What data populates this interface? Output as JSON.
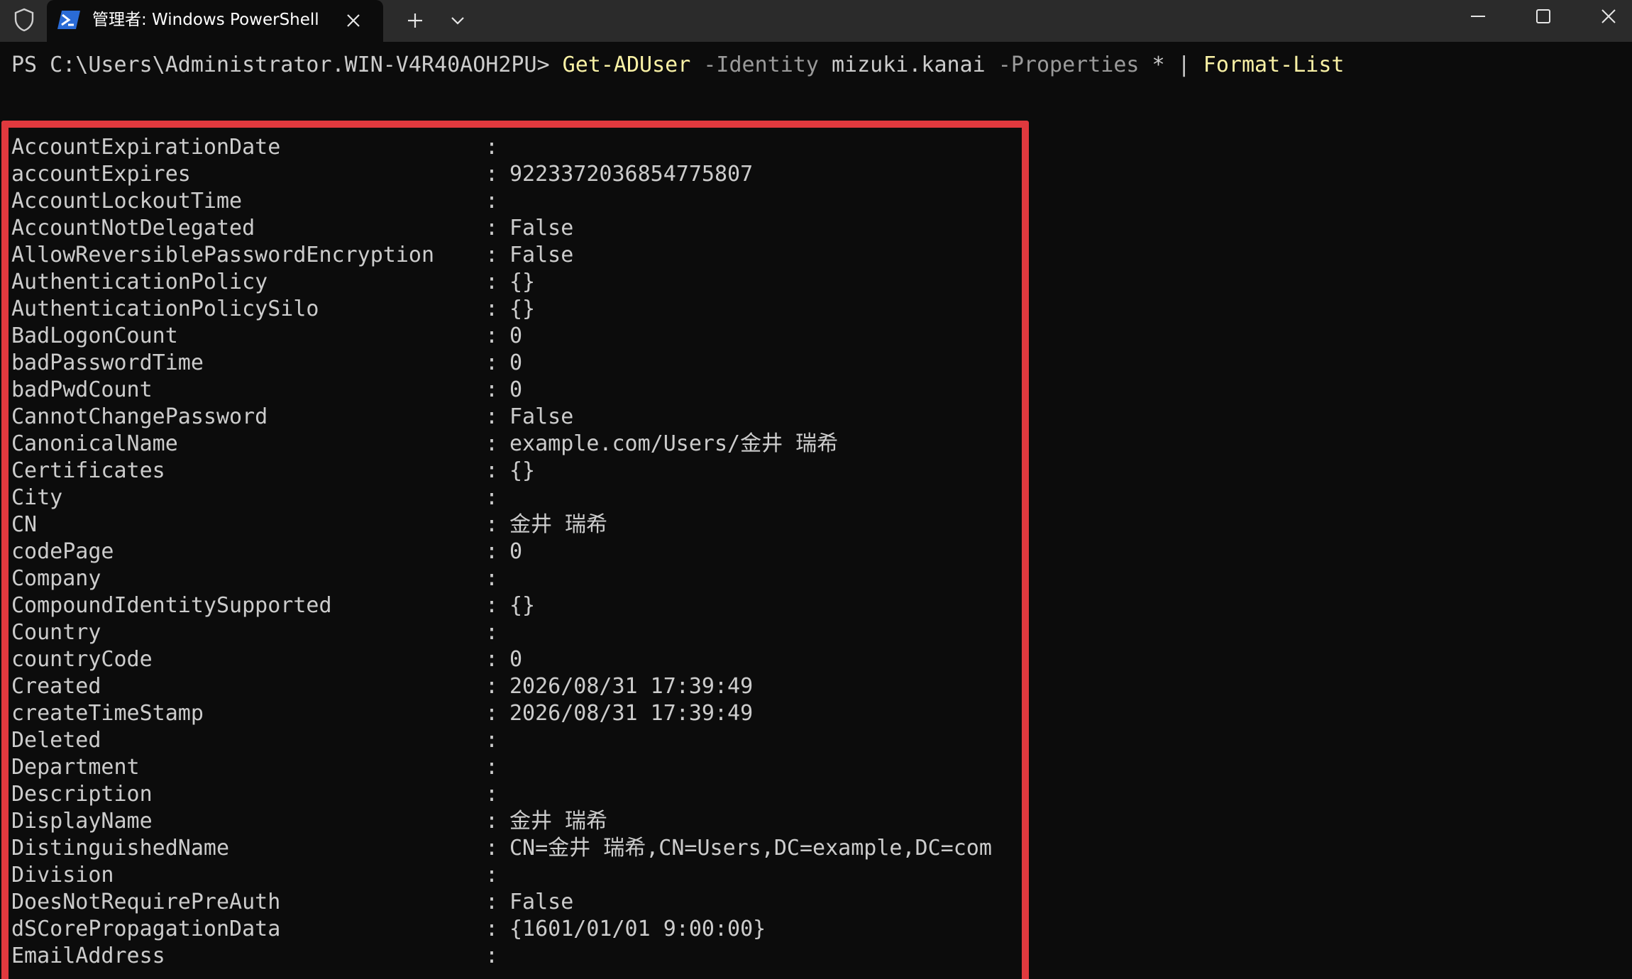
{
  "titlebar": {
    "tab_title": "管理者: Windows PowerShell",
    "icons": {
      "admin": "shield-icon",
      "tab": "powershell-icon",
      "close_tab": "close-icon",
      "new_tab": "plus-icon",
      "dropdown": "chevron-down-icon",
      "minimize": "minimize-icon",
      "maximize": "maximize-icon",
      "close_window": "close-icon"
    }
  },
  "terminal": {
    "prompt": "PS C:\\Users\\Administrator.WIN-V4R40AOH2PU>",
    "command": "Get-ADUser",
    "param_identity": "-Identity",
    "identity_value": "mizuki.kanai",
    "param_properties": "-Properties",
    "properties_value": "*",
    "pipe": "|",
    "pipe_command": "Format-List",
    "separator": ":",
    "colors": {
      "background": "#0c0c0c",
      "text": "#cccccc",
      "command": "#f9f1a5",
      "parameter": "#9a9a9a",
      "highlight_border": "#e0393e"
    },
    "properties": [
      {
        "name": "AccountExpirationDate",
        "value": ""
      },
      {
        "name": "accountExpires",
        "value": "9223372036854775807"
      },
      {
        "name": "AccountLockoutTime",
        "value": ""
      },
      {
        "name": "AccountNotDelegated",
        "value": "False"
      },
      {
        "name": "AllowReversiblePasswordEncryption",
        "value": "False"
      },
      {
        "name": "AuthenticationPolicy",
        "value": "{}"
      },
      {
        "name": "AuthenticationPolicySilo",
        "value": "{}"
      },
      {
        "name": "BadLogonCount",
        "value": "0"
      },
      {
        "name": "badPasswordTime",
        "value": "0"
      },
      {
        "name": "badPwdCount",
        "value": "0"
      },
      {
        "name": "CannotChangePassword",
        "value": "False"
      },
      {
        "name": "CanonicalName",
        "value": "example.com/Users/金井 瑞希"
      },
      {
        "name": "Certificates",
        "value": "{}"
      },
      {
        "name": "City",
        "value": ""
      },
      {
        "name": "CN",
        "value": "金井 瑞希"
      },
      {
        "name": "codePage",
        "value": "0"
      },
      {
        "name": "Company",
        "value": ""
      },
      {
        "name": "CompoundIdentitySupported",
        "value": "{}"
      },
      {
        "name": "Country",
        "value": ""
      },
      {
        "name": "countryCode",
        "value": "0"
      },
      {
        "name": "Created",
        "value": "2026/08/31 17:39:49"
      },
      {
        "name": "createTimeStamp",
        "value": "2026/08/31 17:39:49"
      },
      {
        "name": "Deleted",
        "value": ""
      },
      {
        "name": "Department",
        "value": ""
      },
      {
        "name": "Description",
        "value": ""
      },
      {
        "name": "DisplayName",
        "value": "金井 瑞希"
      },
      {
        "name": "DistinguishedName",
        "value": "CN=金井 瑞希,CN=Users,DC=example,DC=com"
      },
      {
        "name": "Division",
        "value": ""
      },
      {
        "name": "DoesNotRequirePreAuth",
        "value": "False"
      },
      {
        "name": "dSCorePropagationData",
        "value": "{1601/01/01 9:00:00}"
      },
      {
        "name": "EmailAddress",
        "value": ""
      }
    ]
  }
}
